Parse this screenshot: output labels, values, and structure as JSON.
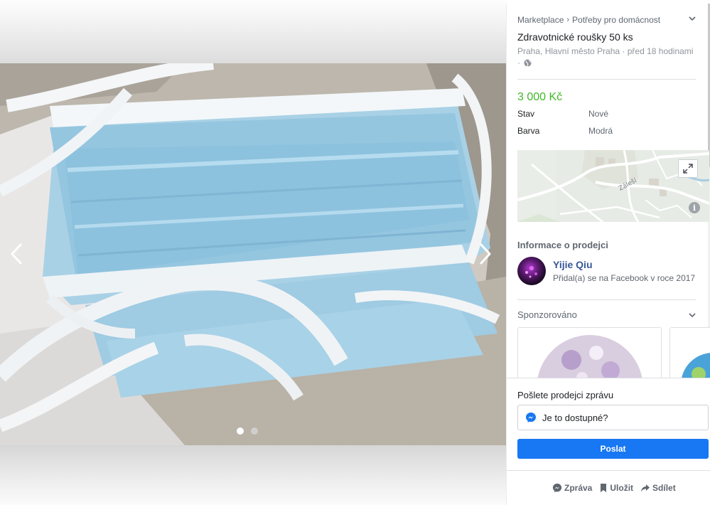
{
  "breadcrumb": {
    "root": "Marketplace",
    "separator": "›",
    "category": "Potřeby pro domácnost"
  },
  "listing": {
    "title": "Zdravotnické roušky 50 ks",
    "location": "Praha, Hlavní město Praha · před 18 hodinami",
    "location_suffix": "·",
    "price": "3 000 Kč",
    "attributes": [
      {
        "key": "Stav",
        "value": "Nové"
      },
      {
        "key": "Barva",
        "value": "Modrá"
      }
    ]
  },
  "map": {
    "label": "Záleší"
  },
  "seller_section": {
    "title": "Informace o prodejci",
    "name": "Yijie Qiu",
    "joined": "Přidal(a) se na Facebook v roce 2017"
  },
  "sponsored": {
    "title": "Sponzorováno"
  },
  "message": {
    "label": "Pošlete prodejci zprávu",
    "input_value": "Je to dostupné?",
    "send_label": "Poslat"
  },
  "actions": [
    {
      "icon": "messenger-icon",
      "label": "Zpráva"
    },
    {
      "icon": "bookmark-icon",
      "label": "Uložit"
    },
    {
      "icon": "share-icon",
      "label": "Sdílet"
    }
  ],
  "gallery": {
    "image_count": 2,
    "current_index": 1
  },
  "colors": {
    "price": "#42b72a",
    "primary": "#1877f2",
    "seller_name": "#365899"
  }
}
